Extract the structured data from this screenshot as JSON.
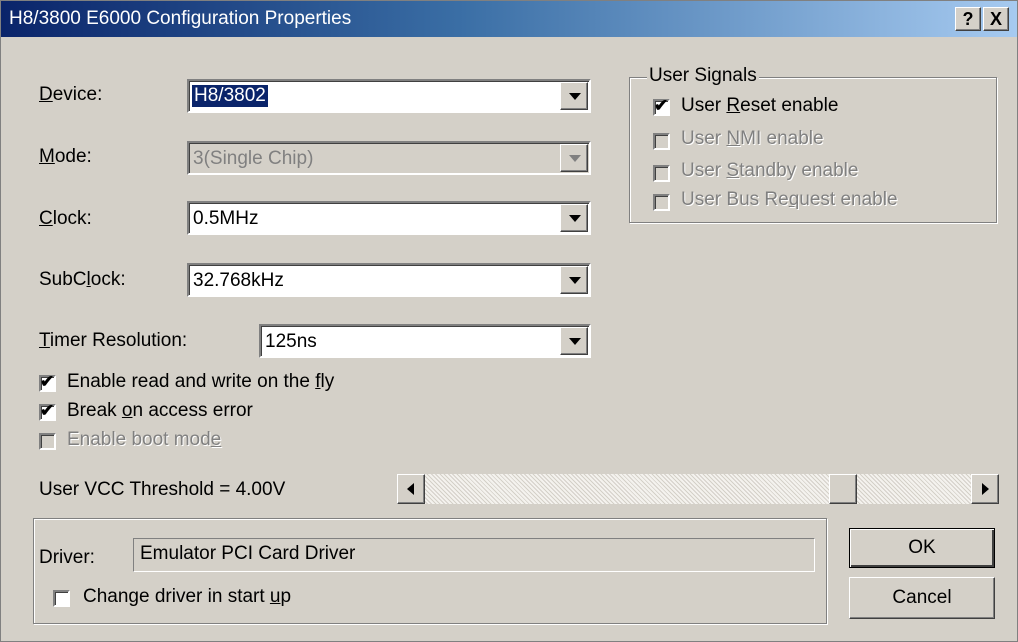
{
  "window": {
    "title": "H8/3800 E6000 Configuration Properties",
    "help_label": "?",
    "close_label": "X"
  },
  "fields": {
    "device": {
      "label_pre": "",
      "label_key": "D",
      "label_post": "evice:",
      "value": "H8/3802"
    },
    "mode": {
      "label_pre": "",
      "label_key": "M",
      "label_post": "ode:",
      "value": "3(Single Chip)"
    },
    "clock": {
      "label_pre": "",
      "label_key": "C",
      "label_post": "lock:",
      "value": "0.5MHz"
    },
    "subclock": {
      "label_pre": "SubC",
      "label_key": "l",
      "label_post": "ock:",
      "value": "32.768kHz"
    },
    "timer": {
      "label_pre": "",
      "label_key": "T",
      "label_post": "imer Resolution:",
      "value": "125ns"
    }
  },
  "options": {
    "fly": {
      "pre": "Enable read and write on the ",
      "key": "f",
      "post": "ly",
      "checked": true
    },
    "break": {
      "pre": "Break ",
      "key": "o",
      "post": "n access error",
      "checked": true
    },
    "boot": {
      "pre": "Enable boot mod",
      "key": "e",
      "post": "",
      "checked": false
    }
  },
  "user_signals": {
    "title": "User Signals",
    "reset": {
      "pre": "User ",
      "key": "R",
      "post": "eset enable",
      "checked": true
    },
    "nmi": {
      "pre": "User ",
      "key": "N",
      "post": "MI enable",
      "checked": false
    },
    "standby": {
      "pre": "User ",
      "key": "S",
      "post": "tandby enable",
      "checked": false
    },
    "busreq": {
      "pre": "User Bus Re",
      "key": "q",
      "post": "uest enable",
      "checked": false
    }
  },
  "vcc": {
    "label": "User VCC Threshold = 4.00V",
    "slider_fraction": 0.78
  },
  "driver": {
    "label": "Driver:",
    "value": "Emulator PCI Card Driver",
    "change_pre": "Change driver in start ",
    "change_key": "u",
    "change_post": "p",
    "change_checked": false
  },
  "buttons": {
    "ok": "OK",
    "cancel": "Cancel"
  }
}
